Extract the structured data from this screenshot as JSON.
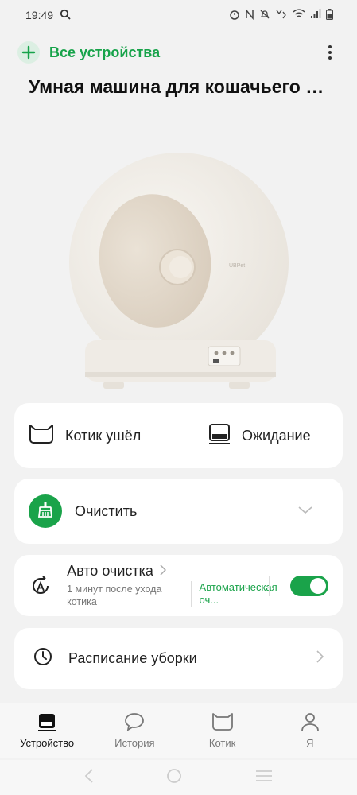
{
  "status_bar": {
    "time": "19:49",
    "icons": [
      "search-icon",
      "alarm-icon",
      "nfc-icon",
      "mute-icon",
      "volte-icon",
      "wifi-icon",
      "signal-icon",
      "battery-icon"
    ]
  },
  "header": {
    "all_devices_label": "Все устройства",
    "device_title": "Умная машина для кошачьего ту..."
  },
  "device_image": {
    "brand_text": "UBPet"
  },
  "status_card": {
    "cat_status": "Котик ушёл",
    "device_state": "Ожидание"
  },
  "clean_card": {
    "label": "Очистить"
  },
  "auto_clean_card": {
    "title": "Авто очистка",
    "subtitle": "1 минут после ухода котика",
    "mode": "Автоматическая оч...",
    "enabled": true
  },
  "schedule_card": {
    "label": "Расписание уборки"
  },
  "bottom_nav": {
    "items": [
      {
        "label": "Устройство",
        "icon": "device-icon",
        "active": true
      },
      {
        "label": "История",
        "icon": "chat-icon",
        "active": false
      },
      {
        "label": "Котик",
        "icon": "cat-icon",
        "active": false
      },
      {
        "label": "Я",
        "icon": "profile-icon",
        "active": false
      }
    ]
  },
  "colors": {
    "accent": "#1aa34a",
    "background": "#f2f2f2",
    "card": "#ffffff"
  }
}
